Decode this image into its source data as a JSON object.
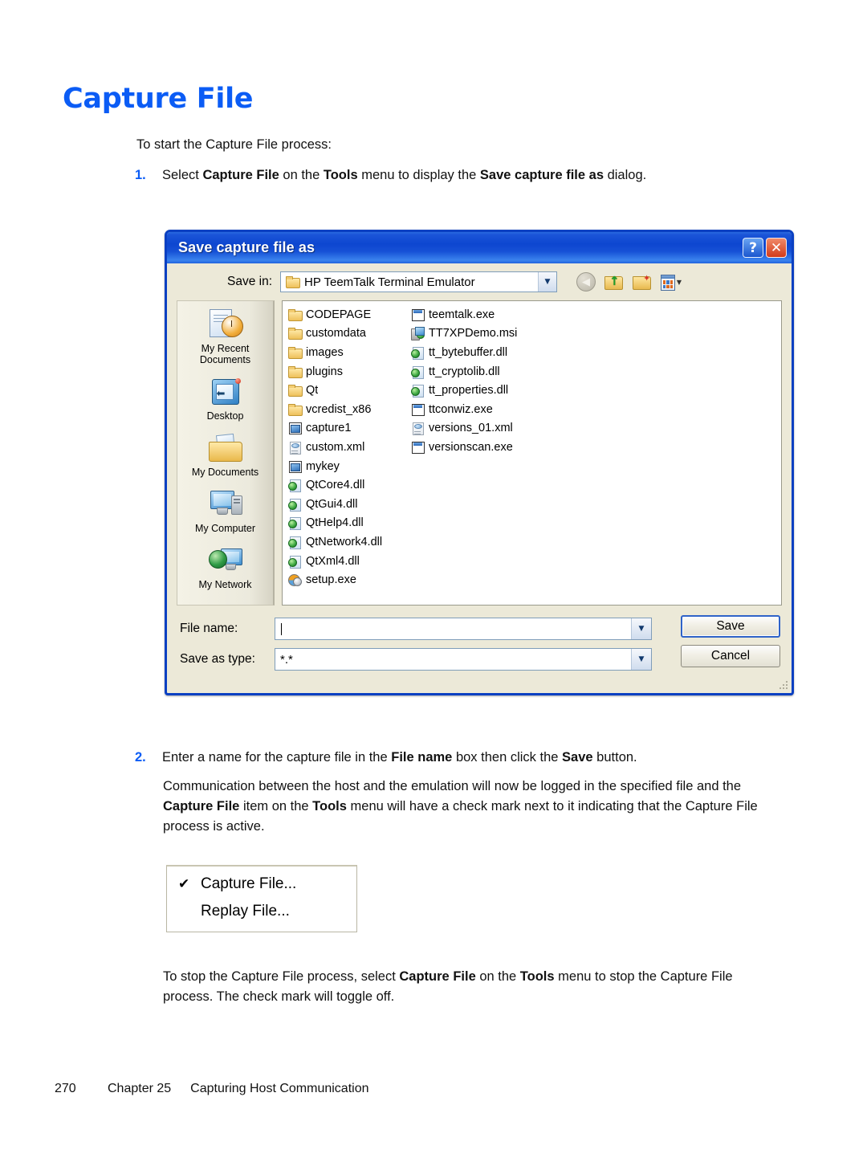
{
  "document": {
    "title": "Capture File",
    "intro": "To start the Capture File process:",
    "steps": [
      {
        "num": "1.",
        "parts": [
          {
            "t": "Select ",
            "b": false
          },
          {
            "t": "Capture File",
            "b": true
          },
          {
            "t": " on the ",
            "b": false
          },
          {
            "t": "Tools",
            "b": true
          },
          {
            "t": " menu to display the ",
            "b": false
          },
          {
            "t": "Save capture file as",
            "b": true
          },
          {
            "t": " dialog.",
            "b": false
          }
        ]
      },
      {
        "num": "2.",
        "parts": [
          {
            "t": "Enter a name for the capture file in the ",
            "b": false
          },
          {
            "t": "File name",
            "b": true
          },
          {
            "t": " box then click the ",
            "b": false
          },
          {
            "t": "Save",
            "b": true
          },
          {
            "t": " button.",
            "b": false
          }
        ]
      }
    ],
    "paragraph_logged": [
      {
        "t": "Communication between the host and the emulation will now be logged in the specified file and the ",
        "b": false
      },
      {
        "t": "Capture File",
        "b": true
      },
      {
        "t": " item on the ",
        "b": false
      },
      {
        "t": "Tools",
        "b": true
      },
      {
        "t": " menu will have a check mark next to it indicating that the Capture File process is active.",
        "b": false
      }
    ],
    "paragraph_stop": [
      {
        "t": "To stop the Capture File process, select ",
        "b": false
      },
      {
        "t": "Capture File",
        "b": true
      },
      {
        "t": " on the ",
        "b": false
      },
      {
        "t": "Tools",
        "b": true
      },
      {
        "t": " menu to stop the Capture File process. The check mark will toggle off.",
        "b": false
      }
    ],
    "footer": {
      "page_number": "270",
      "chapter": "Chapter 25",
      "chapter_title": "Capturing Host Communication"
    },
    "heading_color": "#0b5cf5"
  },
  "dialog": {
    "title": "Save capture file as",
    "title_buttons": [
      {
        "name": "help-button",
        "glyph": "?"
      },
      {
        "name": "close-button",
        "glyph": "✕"
      }
    ],
    "save_in": {
      "label": "Save in:",
      "value": "HP TeemTalk Terminal Emulator"
    },
    "toolbar": [
      {
        "name": "back-button",
        "label": "Back"
      },
      {
        "name": "up-one-level-button",
        "label": "Up One Level"
      },
      {
        "name": "create-new-folder-button",
        "label": "Create New Folder"
      },
      {
        "name": "views-button",
        "label": "Views"
      }
    ],
    "places": [
      {
        "label": "My Recent Documents",
        "icon": "recent-documents-icon"
      },
      {
        "label": "Desktop",
        "icon": "desktop-icon"
      },
      {
        "label": "My Documents",
        "icon": "my-documents-icon"
      },
      {
        "label": "My Computer",
        "icon": "my-computer-icon"
      },
      {
        "label": "My Network",
        "icon": "my-network-icon"
      }
    ],
    "files": [
      {
        "name": "CODEPAGE",
        "type": "folder"
      },
      {
        "name": "customdata",
        "type": "folder"
      },
      {
        "name": "images",
        "type": "folder"
      },
      {
        "name": "plugins",
        "type": "folder"
      },
      {
        "name": "Qt",
        "type": "folder"
      },
      {
        "name": "vcredist_x86",
        "type": "folder"
      },
      {
        "name": "capture1",
        "type": "key"
      },
      {
        "name": "custom.xml",
        "type": "xml"
      },
      {
        "name": "mykey",
        "type": "key"
      },
      {
        "name": "QtCore4.dll",
        "type": "dll"
      },
      {
        "name": "QtGui4.dll",
        "type": "dll"
      },
      {
        "name": "QtHelp4.dll",
        "type": "dll"
      },
      {
        "name": "QtNetwork4.dll",
        "type": "dll"
      },
      {
        "name": "QtXml4.dll",
        "type": "dll"
      },
      {
        "name": "setup.exe",
        "type": "setup"
      },
      {
        "name": "teemtalk.exe",
        "type": "exe"
      },
      {
        "name": "TT7XPDemo.msi",
        "type": "msi"
      },
      {
        "name": "tt_bytebuffer.dll",
        "type": "dll"
      },
      {
        "name": "tt_cryptolib.dll",
        "type": "dll"
      },
      {
        "name": "tt_properties.dll",
        "type": "dll"
      },
      {
        "name": "ttconwiz.exe",
        "type": "exe"
      },
      {
        "name": "versions_01.xml",
        "type": "xml"
      },
      {
        "name": "versionscan.exe",
        "type": "exe"
      }
    ],
    "file_name": {
      "label": "File name:",
      "value": ""
    },
    "save_as_type": {
      "label": "Save as type:",
      "value": "*.*"
    },
    "buttons": {
      "save": "Save",
      "cancel": "Cancel"
    },
    "colors": {
      "titlebar": "#0d46d0",
      "face": "#ece9d8",
      "border": "#0a40c2"
    }
  },
  "menu_shot": {
    "items": [
      {
        "label": "Capture File...",
        "checked": "✔"
      },
      {
        "label": "Replay File...",
        "checked": ""
      }
    ]
  }
}
